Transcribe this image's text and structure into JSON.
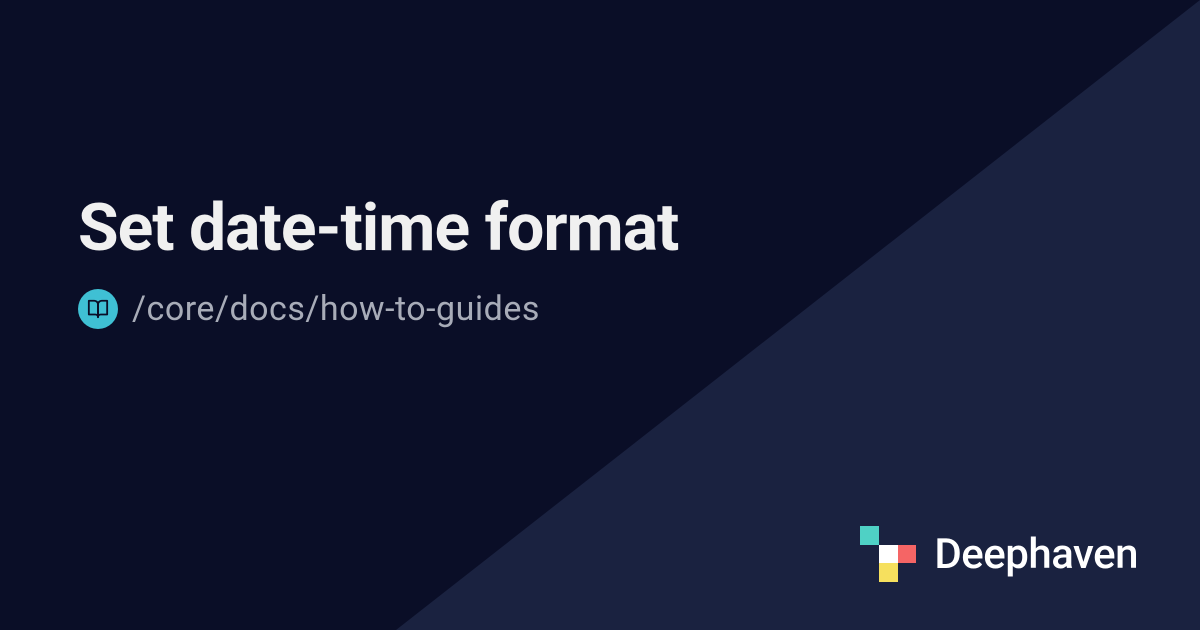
{
  "title": "Set date-time format",
  "breadcrumb": {
    "path": "/core/docs/how-to-guides"
  },
  "brand": {
    "name": "Deephaven",
    "logo_colors": {
      "teal": "#4fd1c5",
      "white": "#ffffff",
      "red": "#f56565",
      "yellow": "#f6e05e"
    }
  },
  "colors": {
    "bg_dark": "#0a0e27",
    "bg_diagonal": "#1a2240",
    "title_text": "#f0f0f0",
    "breadcrumb_text": "#a8acb8",
    "icon_circle": "#3fc0d4"
  }
}
